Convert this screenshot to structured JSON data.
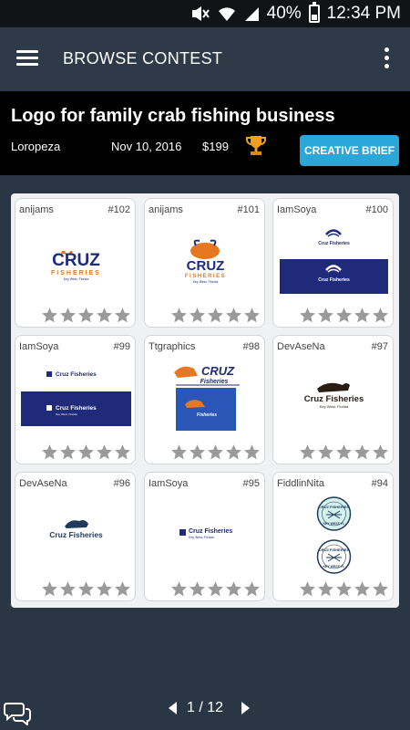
{
  "status_bar": {
    "battery_percent": "40%",
    "time": "12:34 PM",
    "icons": [
      "mute-icon",
      "wifi-icon",
      "signal-icon",
      "battery-icon"
    ]
  },
  "toolbar": {
    "title": "BROWSE CONTEST",
    "menu_icon": "hamburger-menu-icon",
    "overflow_icon": "more-vertical-icon"
  },
  "contest": {
    "title": "Logo for family crab fishing business",
    "holder": "Loropeza",
    "date": "Nov 10, 2016",
    "prize": "$199",
    "trophy_icon": "trophy-icon",
    "brief_button": "CREATIVE BRIEF"
  },
  "entries": [
    {
      "designer": "anijams",
      "number": "#102",
      "logo": {
        "main": "CRUZ",
        "sub": "FISHERIES",
        "tag": "Key West, Florida"
      },
      "rating": 0
    },
    {
      "designer": "anijams",
      "number": "#101",
      "logo": {
        "main": "CRUZ",
        "sub": "FISHERIES",
        "tag": "Key West, Florida"
      },
      "rating": 0
    },
    {
      "designer": "IamSoya",
      "number": "#100",
      "logo": {
        "main": "Cruz Fisheries",
        "sub": "Cruz Fisheries",
        "tag": ""
      },
      "rating": 0
    },
    {
      "designer": "IamSoya",
      "number": "#99",
      "logo": {
        "main": "Cruz Fisheries",
        "sub": "Cruz Fisheries",
        "tag": "Key West, Florida"
      },
      "rating": 0
    },
    {
      "designer": "Ttgraphics",
      "number": "#98",
      "logo": {
        "main": "CRUZ",
        "sub": "Fisheries",
        "tag": "Fisheries"
      },
      "rating": 0
    },
    {
      "designer": "DevAseNa",
      "number": "#97",
      "logo": {
        "main": "Cruz Fisheries",
        "sub": "",
        "tag": "Key West, Florida"
      },
      "rating": 0
    },
    {
      "designer": "DevAseNa",
      "number": "#96",
      "logo": {
        "main": "Cruz Fisheries",
        "sub": "",
        "tag": ""
      },
      "rating": 0
    },
    {
      "designer": "IamSoya",
      "number": "#95",
      "logo": {
        "main": "Cruz Fisheries",
        "sub": "",
        "tag": "Key West, Florida"
      },
      "rating": 0
    },
    {
      "designer": "FiddlinNita",
      "number": "#94",
      "logo": {
        "main": "CRUZ FISHERIES",
        "sub": "KEY WEST, FL",
        "tag": ""
      },
      "rating": 0
    }
  ],
  "pagination": {
    "text": "1 / 12",
    "current": 1,
    "total": 12
  },
  "colors": {
    "background": "#2a3644",
    "toolbar": "#2e3a47",
    "header": "#000000",
    "accent": "#2aa6d8",
    "navy": "#1f2a7a",
    "orange": "#e87722",
    "star": "#9a9a9a"
  },
  "footer": {
    "chat_icon": "chat-bubbles-icon"
  }
}
